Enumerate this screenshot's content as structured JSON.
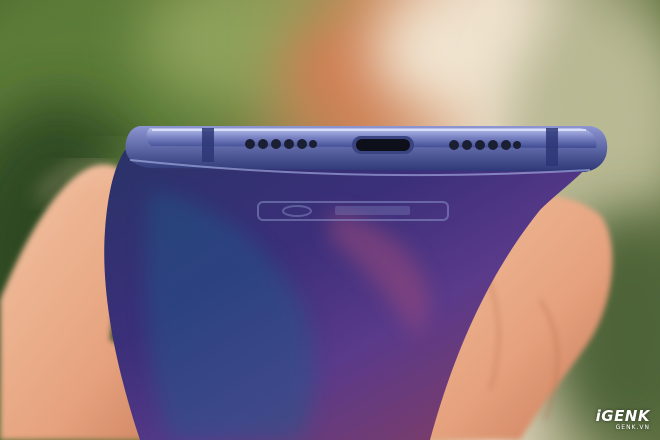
{
  "photo": {
    "subject": "smartphone-bottom-edge-held-in-hand",
    "colors": {
      "background_green": "#4f6a34",
      "background_orange": "#d98a55",
      "background_cream": "#e9dcc8",
      "phone_blue": "#5a62b4",
      "phone_dark": "#1f2a55",
      "frame_silver": "#9aa6d6",
      "skin": "#e9b08f"
    }
  },
  "watermark": {
    "brand": "iGENK",
    "domain": "GENK.VN"
  }
}
